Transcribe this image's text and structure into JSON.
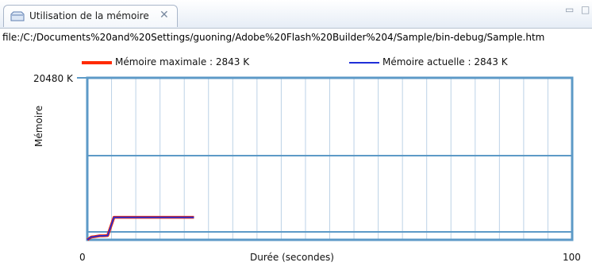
{
  "tab": {
    "title": "Utilisation de la mémoire",
    "close_icon": "close-icon",
    "view_icon": "memory-view-icon"
  },
  "window_controls": {
    "minimize_icon": "minimize-icon",
    "maximize_icon": "maximize-icon"
  },
  "url": "file:/C:/Documents%20and%20Settings/guoning/Adobe%20Flash%20Builder%204/Sample/bin-debug/Sample.htm",
  "chart_data": {
    "type": "line",
    "title": "",
    "xlabel": "Durée (secondes)",
    "ylabel": "Mémoire",
    "xlim": [
      0,
      100
    ],
    "ylim": [
      0,
      20480
    ],
    "x_tick_labels": [
      "0",
      "100"
    ],
    "y_tick_labels": [
      "20480 K"
    ],
    "grid": true,
    "legend_position": "top",
    "series": [
      {
        "name": "Mémoire maximale : 2843 K",
        "color": "#ff2a00",
        "x": [
          0,
          0.8,
          1.5,
          2.5,
          3.5,
          4.2,
          5.5,
          22
        ],
        "y": [
          0,
          350,
          400,
          500,
          520,
          540,
          2843,
          2843
        ]
      },
      {
        "name": "Mémoire actuelle : 2843 K",
        "color": "#1f2fd8",
        "x": [
          0,
          0.8,
          1.5,
          2.5,
          3.5,
          4.2,
          5.5,
          22
        ],
        "y": [
          0,
          350,
          400,
          500,
          520,
          540,
          2843,
          2843
        ]
      }
    ]
  }
}
